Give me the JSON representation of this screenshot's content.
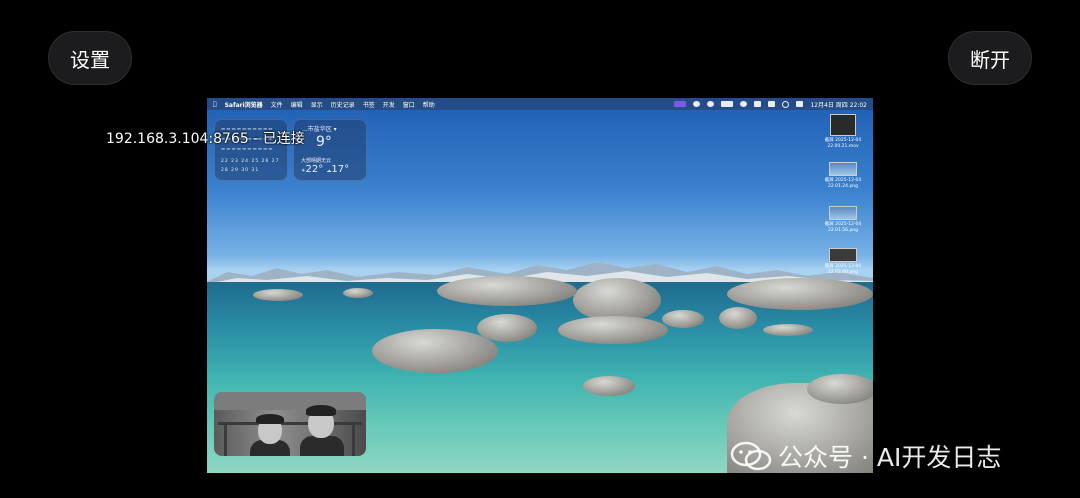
{
  "top": {
    "settings_label": "设置",
    "disconnect_label": "断开"
  },
  "connection": {
    "status_text": "192.168.3.104:8765 - 已连接"
  },
  "remote_screen": {
    "menubar": {
      "apple_icon": "apple-icon",
      "app_name": "Safari浏览器",
      "items": [
        "文件",
        "编辑",
        "显示",
        "历史记录",
        "书签",
        "开发",
        "窗口",
        "帮助"
      ],
      "status_icons": [
        "screen-share-icon",
        "record-icon",
        "wechat-icon",
        "battery-icon",
        "moon-icon",
        "text-icon",
        "wifi-icon",
        "search-icon",
        "control-center-icon"
      ],
      "clock": "12月4日 周四 22:02"
    },
    "calendar_widget": {
      "rows": [
        "22 23 24 25 26 27",
        "28 29 30 31"
      ]
    },
    "weather_widget": {
      "location": "...市盐华区 ▾",
      "temperature": "9°",
      "condition": "大部晴朗无云",
      "high": "22°",
      "low": "17°"
    },
    "desktop_files": [
      {
        "caption": "截屏 2025-12-04 22.00.21.mov"
      },
      {
        "caption": "截屏 2025-12-04 22.01.24.png"
      },
      {
        "caption": "截屏 2025-12-04 22.01.56.png"
      },
      {
        "caption": "截屏 2025-12-04 22.02.00.png"
      }
    ]
  },
  "watermark": {
    "text": "公众号 · AI开发日志",
    "icon": "wechat-icon"
  }
}
